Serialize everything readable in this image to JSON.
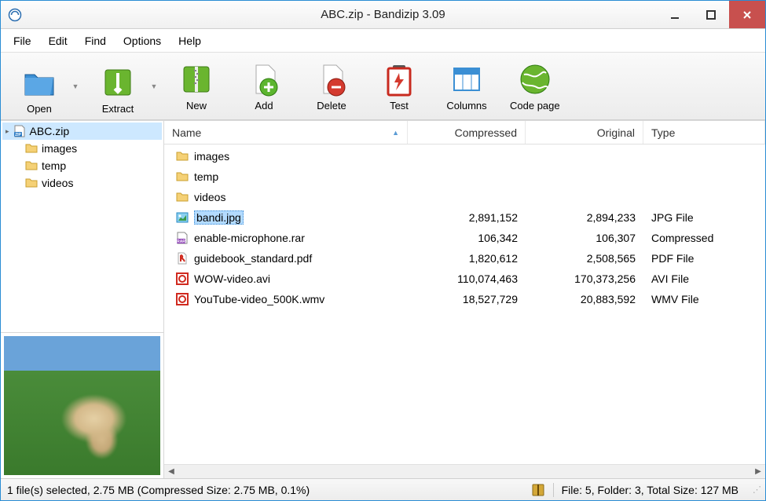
{
  "window": {
    "title": "ABC.zip - Bandizip 3.09"
  },
  "menu": {
    "file": "File",
    "edit": "Edit",
    "find": "Find",
    "options": "Options",
    "help": "Help"
  },
  "toolbar": {
    "open": "Open",
    "extract": "Extract",
    "new": "New",
    "add": "Add",
    "delete": "Delete",
    "test": "Test",
    "columns": "Columns",
    "codepage": "Code page"
  },
  "tree": {
    "root": "ABC.zip",
    "children": [
      "images",
      "temp",
      "videos"
    ]
  },
  "columns": {
    "name": "Name",
    "compressed": "Compressed",
    "original": "Original",
    "type": "Type"
  },
  "files": [
    {
      "name": "images",
      "kind": "folder",
      "compressed": "",
      "original": "",
      "type": ""
    },
    {
      "name": "temp",
      "kind": "folder",
      "compressed": "",
      "original": "",
      "type": ""
    },
    {
      "name": "videos",
      "kind": "folder",
      "compressed": "",
      "original": "",
      "type": ""
    },
    {
      "name": "bandi.jpg",
      "kind": "jpg",
      "compressed": "2,891,152",
      "original": "2,894,233",
      "type": "JPG File",
      "selected": true
    },
    {
      "name": "enable-microphone.rar",
      "kind": "rar",
      "compressed": "106,342",
      "original": "106,307",
      "type": "Compressed"
    },
    {
      "name": "guidebook_standard.pdf",
      "kind": "pdf",
      "compressed": "1,820,612",
      "original": "2,508,565",
      "type": "PDF File"
    },
    {
      "name": "WOW-video.avi",
      "kind": "video",
      "compressed": "110,074,463",
      "original": "170,373,256",
      "type": "AVI File"
    },
    {
      "name": "YouTube-video_500K.wmv",
      "kind": "video",
      "compressed": "18,527,729",
      "original": "20,883,592",
      "type": "WMV File"
    }
  ],
  "status": {
    "left": "1 file(s) selected, 2.75 MB (Compressed Size: 2.75 MB, 0.1%)",
    "right": "File: 5, Folder: 3, Total Size: 127 MB"
  }
}
